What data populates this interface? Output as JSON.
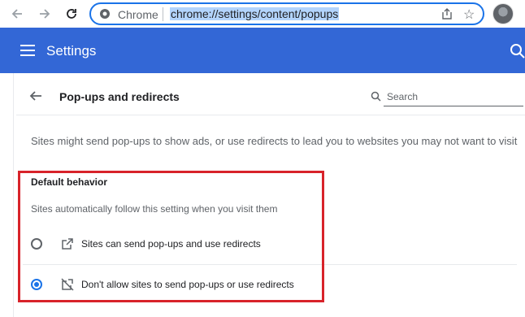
{
  "browser": {
    "omnibox_label": "Chrome",
    "url": "chrome://settings/content/popups"
  },
  "header": {
    "title": "Settings"
  },
  "page": {
    "title": "Pop-ups and redirects",
    "search_placeholder": "Search",
    "description": "Sites might send pop-ups to show ads, or use redirects to lead you to websites you may not want to visit"
  },
  "default_behavior": {
    "title": "Default behavior",
    "subtitle": "Sites automatically follow this setting when you visit them",
    "options": [
      {
        "label": "Sites can send pop-ups and use redirects",
        "selected": false
      },
      {
        "label": "Don't allow sites to send pop-ups or use redirects",
        "selected": true
      }
    ]
  },
  "colors": {
    "header_bg": "#3367d6",
    "accent": "#1a73e8",
    "highlight": "#d8232a"
  }
}
